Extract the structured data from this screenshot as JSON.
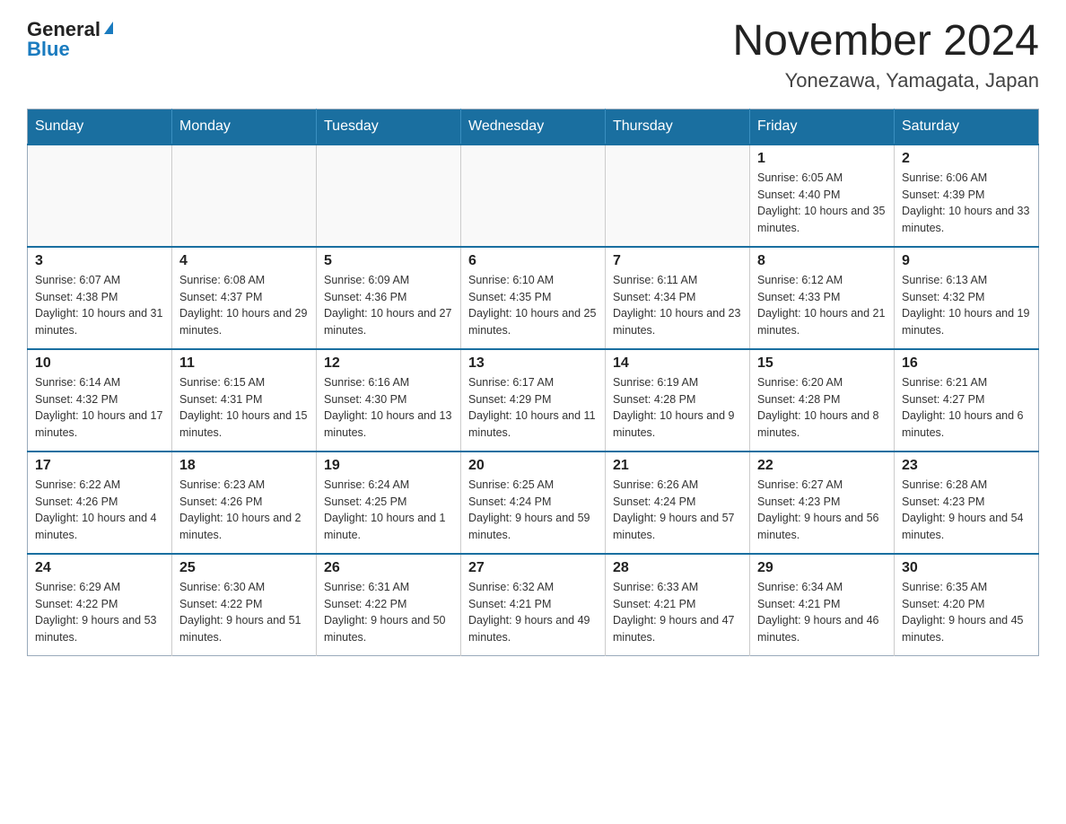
{
  "logo": {
    "general_text": "General",
    "blue_text": "Blue"
  },
  "title": {
    "month_year": "November 2024",
    "location": "Yonezawa, Yamagata, Japan"
  },
  "weekdays": [
    "Sunday",
    "Monday",
    "Tuesday",
    "Wednesday",
    "Thursday",
    "Friday",
    "Saturday"
  ],
  "weeks": [
    [
      {
        "day": "",
        "info": ""
      },
      {
        "day": "",
        "info": ""
      },
      {
        "day": "",
        "info": ""
      },
      {
        "day": "",
        "info": ""
      },
      {
        "day": "",
        "info": ""
      },
      {
        "day": "1",
        "info": "Sunrise: 6:05 AM\nSunset: 4:40 PM\nDaylight: 10 hours and 35 minutes."
      },
      {
        "day": "2",
        "info": "Sunrise: 6:06 AM\nSunset: 4:39 PM\nDaylight: 10 hours and 33 minutes."
      }
    ],
    [
      {
        "day": "3",
        "info": "Sunrise: 6:07 AM\nSunset: 4:38 PM\nDaylight: 10 hours and 31 minutes."
      },
      {
        "day": "4",
        "info": "Sunrise: 6:08 AM\nSunset: 4:37 PM\nDaylight: 10 hours and 29 minutes."
      },
      {
        "day": "5",
        "info": "Sunrise: 6:09 AM\nSunset: 4:36 PM\nDaylight: 10 hours and 27 minutes."
      },
      {
        "day": "6",
        "info": "Sunrise: 6:10 AM\nSunset: 4:35 PM\nDaylight: 10 hours and 25 minutes."
      },
      {
        "day": "7",
        "info": "Sunrise: 6:11 AM\nSunset: 4:34 PM\nDaylight: 10 hours and 23 minutes."
      },
      {
        "day": "8",
        "info": "Sunrise: 6:12 AM\nSunset: 4:33 PM\nDaylight: 10 hours and 21 minutes."
      },
      {
        "day": "9",
        "info": "Sunrise: 6:13 AM\nSunset: 4:32 PM\nDaylight: 10 hours and 19 minutes."
      }
    ],
    [
      {
        "day": "10",
        "info": "Sunrise: 6:14 AM\nSunset: 4:32 PM\nDaylight: 10 hours and 17 minutes."
      },
      {
        "day": "11",
        "info": "Sunrise: 6:15 AM\nSunset: 4:31 PM\nDaylight: 10 hours and 15 minutes."
      },
      {
        "day": "12",
        "info": "Sunrise: 6:16 AM\nSunset: 4:30 PM\nDaylight: 10 hours and 13 minutes."
      },
      {
        "day": "13",
        "info": "Sunrise: 6:17 AM\nSunset: 4:29 PM\nDaylight: 10 hours and 11 minutes."
      },
      {
        "day": "14",
        "info": "Sunrise: 6:19 AM\nSunset: 4:28 PM\nDaylight: 10 hours and 9 minutes."
      },
      {
        "day": "15",
        "info": "Sunrise: 6:20 AM\nSunset: 4:28 PM\nDaylight: 10 hours and 8 minutes."
      },
      {
        "day": "16",
        "info": "Sunrise: 6:21 AM\nSunset: 4:27 PM\nDaylight: 10 hours and 6 minutes."
      }
    ],
    [
      {
        "day": "17",
        "info": "Sunrise: 6:22 AM\nSunset: 4:26 PM\nDaylight: 10 hours and 4 minutes."
      },
      {
        "day": "18",
        "info": "Sunrise: 6:23 AM\nSunset: 4:26 PM\nDaylight: 10 hours and 2 minutes."
      },
      {
        "day": "19",
        "info": "Sunrise: 6:24 AM\nSunset: 4:25 PM\nDaylight: 10 hours and 1 minute."
      },
      {
        "day": "20",
        "info": "Sunrise: 6:25 AM\nSunset: 4:24 PM\nDaylight: 9 hours and 59 minutes."
      },
      {
        "day": "21",
        "info": "Sunrise: 6:26 AM\nSunset: 4:24 PM\nDaylight: 9 hours and 57 minutes."
      },
      {
        "day": "22",
        "info": "Sunrise: 6:27 AM\nSunset: 4:23 PM\nDaylight: 9 hours and 56 minutes."
      },
      {
        "day": "23",
        "info": "Sunrise: 6:28 AM\nSunset: 4:23 PM\nDaylight: 9 hours and 54 minutes."
      }
    ],
    [
      {
        "day": "24",
        "info": "Sunrise: 6:29 AM\nSunset: 4:22 PM\nDaylight: 9 hours and 53 minutes."
      },
      {
        "day": "25",
        "info": "Sunrise: 6:30 AM\nSunset: 4:22 PM\nDaylight: 9 hours and 51 minutes."
      },
      {
        "day": "26",
        "info": "Sunrise: 6:31 AM\nSunset: 4:22 PM\nDaylight: 9 hours and 50 minutes."
      },
      {
        "day": "27",
        "info": "Sunrise: 6:32 AM\nSunset: 4:21 PM\nDaylight: 9 hours and 49 minutes."
      },
      {
        "day": "28",
        "info": "Sunrise: 6:33 AM\nSunset: 4:21 PM\nDaylight: 9 hours and 47 minutes."
      },
      {
        "day": "29",
        "info": "Sunrise: 6:34 AM\nSunset: 4:21 PM\nDaylight: 9 hours and 46 minutes."
      },
      {
        "day": "30",
        "info": "Sunrise: 6:35 AM\nSunset: 4:20 PM\nDaylight: 9 hours and 45 minutes."
      }
    ]
  ]
}
